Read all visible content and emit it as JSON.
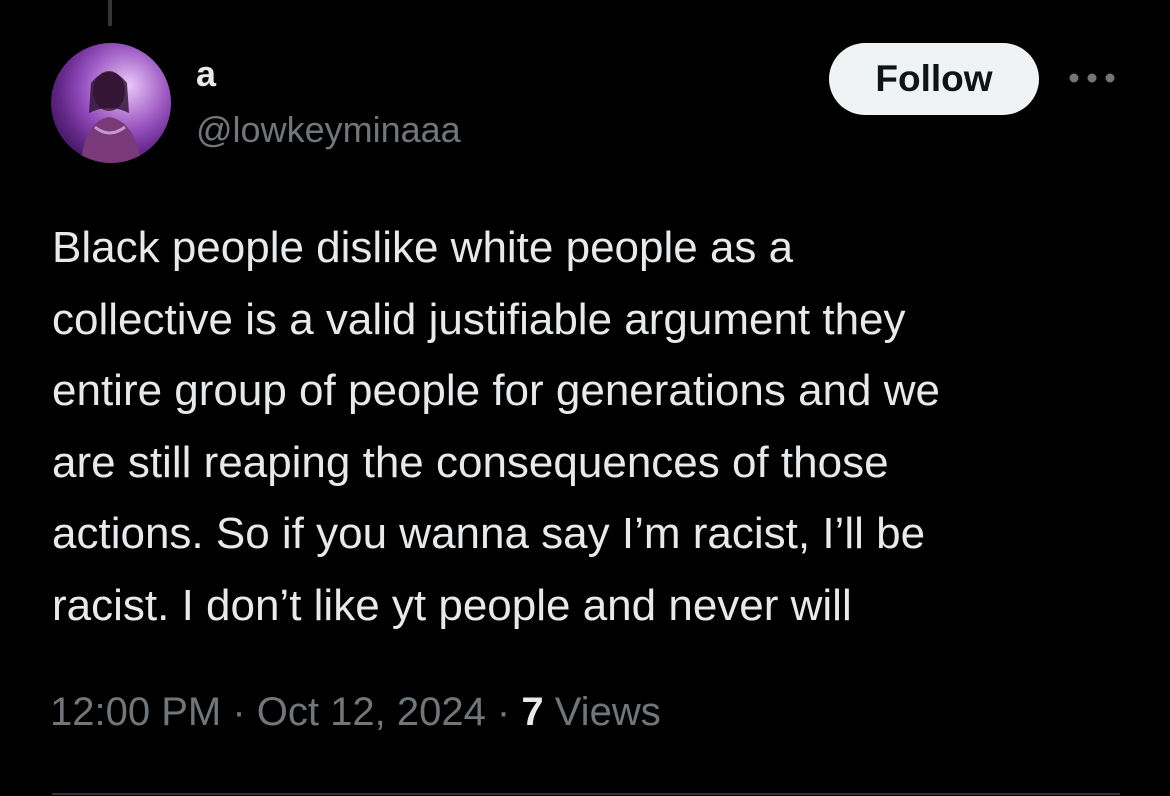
{
  "tweet": {
    "author": {
      "display_name": "a",
      "emoji_icon": "crescent-moon-icon",
      "handle": "@lowkeyminaaa"
    },
    "follow_label": "Follow",
    "more_icon": "more-horizontal-icon",
    "text": "Black people dislike white people as a\ncollective is a valid justifiable argument they\nentire group of people for generations and we\nare still reaping the consequences of those\nactions. So if you wanna say I’m racist, I’ll be\nracist. I don’t like yt people and never will",
    "time": "12:00 PM",
    "separator": " · ",
    "date": "Oct 12, 2024",
    "views_count": "7",
    "views_label": " Views"
  },
  "colors": {
    "background": "#000000",
    "primary_text": "#e7e9ea",
    "secondary_text": "#71767b",
    "follow_button_bg": "#eff3f4",
    "follow_button_text": "#0f1419",
    "moon": "#f5c25b"
  }
}
